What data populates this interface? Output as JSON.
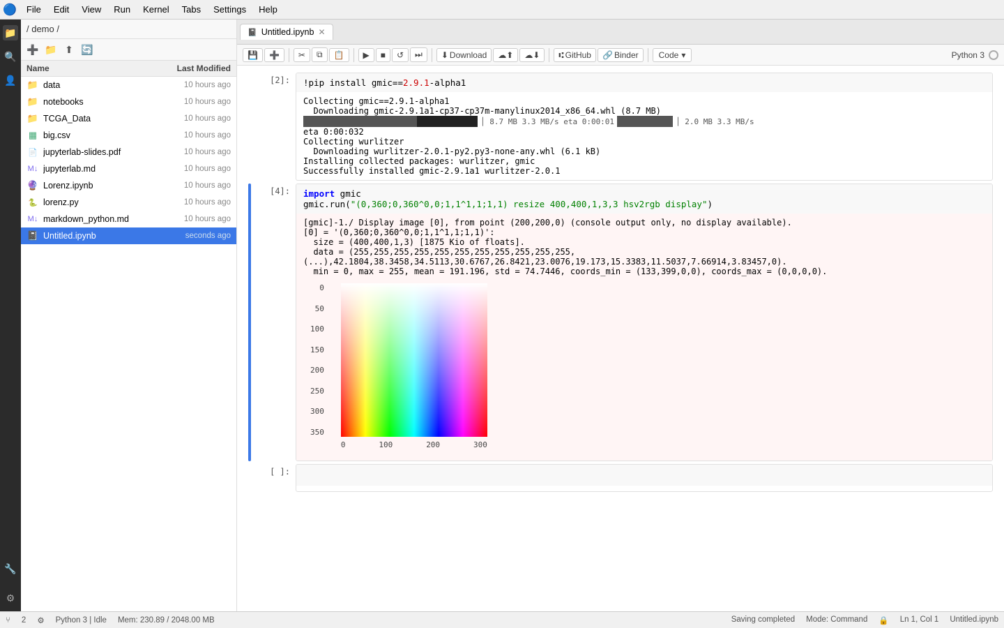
{
  "menubar": {
    "logo": "🔵",
    "items": [
      "File",
      "Edit",
      "View",
      "Run",
      "Kernel",
      "Tabs",
      "Settings",
      "Help"
    ]
  },
  "icon_sidebar": {
    "icons": [
      "📁",
      "🔍",
      "👤",
      "⚙",
      "🔧",
      "⬛"
    ]
  },
  "file_browser": {
    "path": "/ demo /",
    "toolbar_icons": [
      "➕",
      "📁",
      "⬆",
      "🔄"
    ],
    "col_name": "Name",
    "col_modified": "Last Modified",
    "files": [
      {
        "icon": "📁",
        "name": "data",
        "modified": "10 hours ago",
        "type": "folder",
        "active": false
      },
      {
        "icon": "📁",
        "name": "notebooks",
        "modified": "10 hours ago",
        "type": "folder",
        "active": false
      },
      {
        "icon": "📁",
        "name": "TCGA_Data",
        "modified": "10 hours ago",
        "type": "folder",
        "active": false
      },
      {
        "icon": "📊",
        "name": "big.csv",
        "modified": "10 hours ago",
        "type": "csv",
        "active": false
      },
      {
        "icon": "📄",
        "name": "jupyterlab-slides.pdf",
        "modified": "10 hours ago",
        "type": "pdf",
        "active": false
      },
      {
        "icon": "📝",
        "name": "jupyterlab.md",
        "modified": "10 hours ago",
        "type": "md",
        "active": false
      },
      {
        "icon": "🔮",
        "name": "Lorenz.ipynb",
        "modified": "10 hours ago",
        "type": "ipynb",
        "active": false
      },
      {
        "icon": "🐍",
        "name": "lorenz.py",
        "modified": "10 hours ago",
        "type": "py",
        "active": false
      },
      {
        "icon": "📝",
        "name": "markdown_python.md",
        "modified": "10 hours ago",
        "type": "md",
        "active": false
      },
      {
        "icon": "📓",
        "name": "Untitled.ipynb",
        "modified": "seconds ago",
        "type": "ipynb",
        "active": true
      }
    ]
  },
  "notebook": {
    "tab_label": "Untitled.ipynb",
    "tab_icon": "📓",
    "toolbar": {
      "save_label": "💾",
      "add_label": "➕",
      "cut_label": "✂",
      "copy_label": "⧉",
      "paste_label": "📋",
      "run_label": "▶",
      "interrupt_label": "■",
      "restart_label": "↺",
      "fast_forward_label": "⏭",
      "download_label": "Download",
      "upload_label": "⬆",
      "github_label": "GitHub",
      "binder_label": "Binder",
      "cell_type_label": "Code",
      "kernel_label": "Python 3"
    },
    "cells": [
      {
        "id": "cell1",
        "prompt": "[2]:",
        "type": "code",
        "input": "!pip install gmic==2.9.1-alpha1",
        "output_type": "stream",
        "output_lines": [
          "Collecting gmic==2.9.1-alpha1",
          "  Downloading gmic-2.9.1a1-cp37-cp37m-manylinux2014_x86_64.whl (8.7 MB)",
          "     ██████████████████████████████████████████████ 8.7 MB 3.3 MB/s eta 0:00:01",
          "eta 0:00:032",
          "Collecting wurlitzer",
          "  Downloading wurlitzer-2.0.1-py2.py3-none-any.whl (6.1 kB)",
          "Installing collected packages: wurlitzer, gmic",
          "Successfully installed gmic-2.9.1a1 wurlitzer-2.0.1"
        ]
      },
      {
        "id": "cell2",
        "prompt": "[4]:",
        "type": "code",
        "input": "import gmic\ngmic.run(\"(0,360;0,360^0,0;1,1^1,1;1,1) resize 400,400,1,3,3 hsv2rgb display\")",
        "output_type": "mixed",
        "output_text": "[gmic]-1./ Display image [0], from point (200,200,0) (console output only, no display available).\n[0] = '(0,360;0,360^0,0;1,1^1,1;1,1)':\n  size = (400,400,1,3) [1875 Kio of floats].\n  data = (255,255,255,255,255,255,255,255,255,255,255,(...),42.1804,38.3458,34.5113,30.6767,26.8421,23.0076,19.173,15.3383,11.5037,7.66914,3.83457,0).\n  min = 0, max = 255, mean = 191.196, std = 74.7446, coords_min = (133,399,0,0), coords_max = (0,0,0,0).",
        "has_chart": true
      },
      {
        "id": "cell3",
        "prompt": "[ ]:",
        "type": "code",
        "input": "",
        "output_type": "empty"
      }
    ]
  },
  "status_bar": {
    "branch_icon": "⑂",
    "branch_count": "2",
    "kernel_info": "Python 3 | Idle",
    "memory": "Mem: 230.89 / 2048.00 MB",
    "save_status": "Saving completed",
    "mode": "Mode: Command",
    "position": "Ln 1, Col 1",
    "filename": "Untitled.ipynb"
  },
  "chart": {
    "y_labels": [
      "0",
      "50",
      "100",
      "150",
      "200",
      "250",
      "300",
      "350"
    ],
    "x_labels": [
      "0",
      "100",
      "200",
      "300"
    ]
  }
}
